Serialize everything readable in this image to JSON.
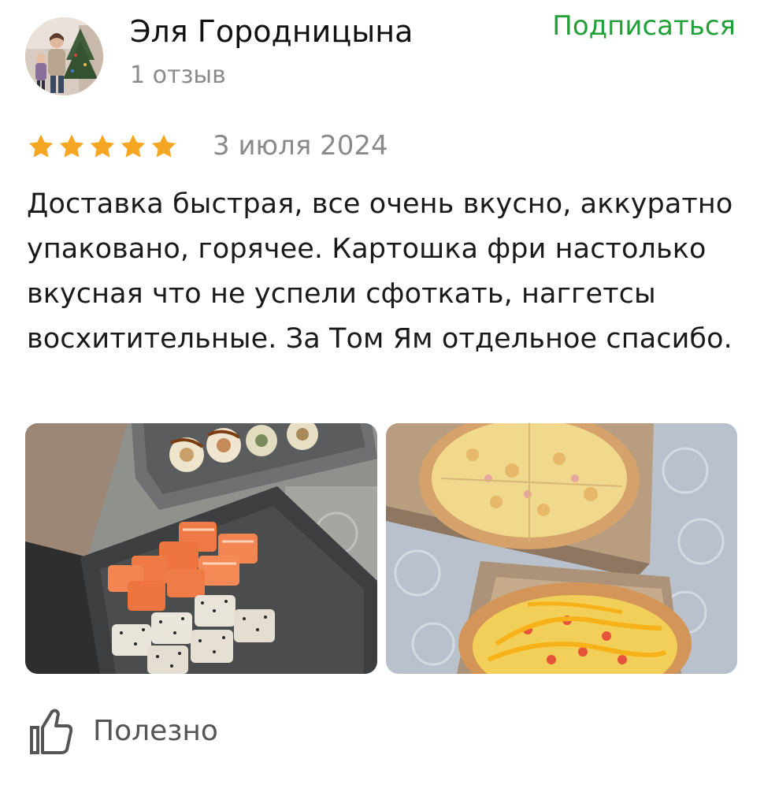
{
  "author": {
    "name": "Эля Городницына",
    "reviews_count": "1 отзыв",
    "avatar_icon": "user-avatar-photo"
  },
  "subscribe": {
    "label": "Подписаться",
    "color": "#21a038"
  },
  "review": {
    "rating": 5,
    "rating_max": 5,
    "star_color": "#f5a623",
    "date": "3 июля 2024",
    "text": "Доставка быстрая, все очень вкусно, аккуратно упаковано, горячее. Картошка фри настолько вкусная что не успели сфоткать, наггетсы восхитительные. За Том Ям отдельное спасибо.",
    "photos": [
      {
        "icon": "sushi-photo"
      },
      {
        "icon": "pizza-photo"
      }
    ]
  },
  "helpful": {
    "label": "Полезно",
    "icon": "thumbs-up-icon"
  }
}
